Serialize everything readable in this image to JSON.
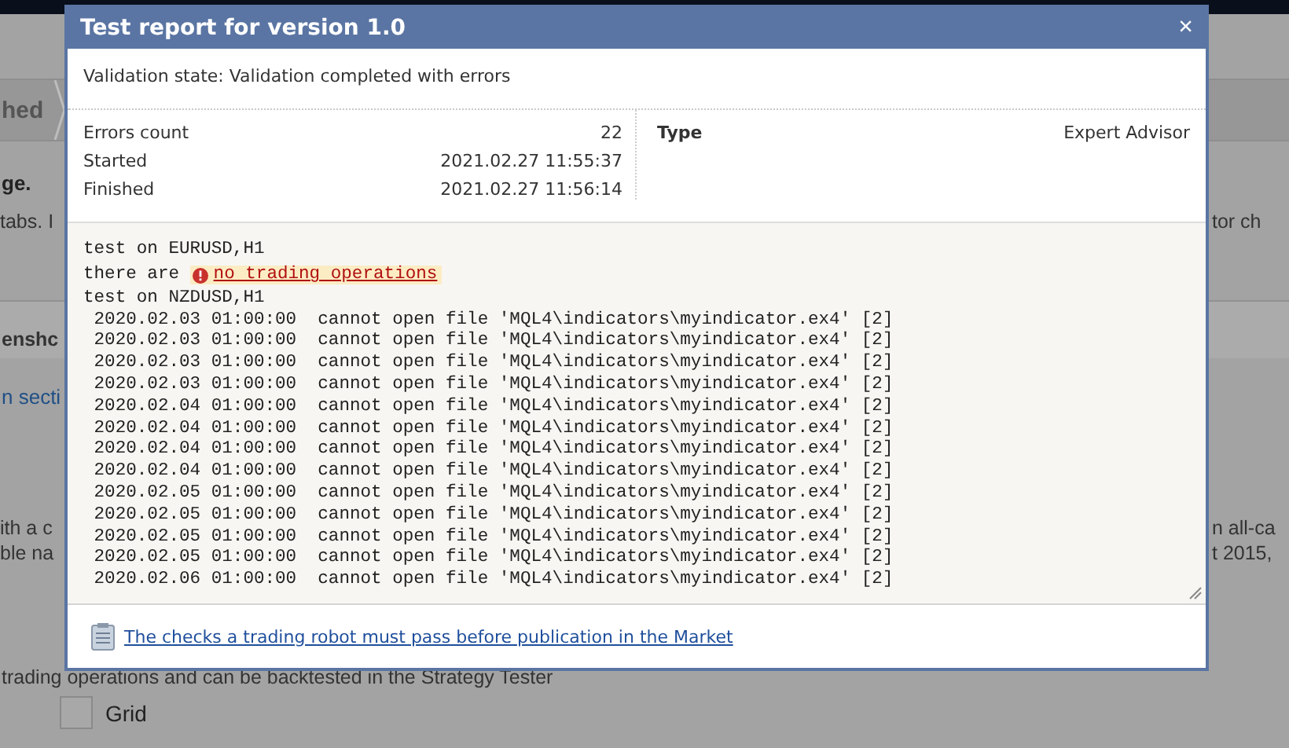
{
  "background": {
    "step_label": "hed",
    "heading_fragment": "ge.",
    "text_left": "tabs. I",
    "text_right": "tor ch",
    "section_tab": "enshc",
    "section_link": "n secti",
    "paragraph_left": [
      "ith a c",
      "ble na"
    ],
    "paragraph_right": [
      "n all-ca",
      "t 2015,"
    ],
    "trading_line": "trading operations and can be backtested in the Strategy Tester",
    "options": [
      {
        "label": "Grid",
        "checked": false
      }
    ]
  },
  "dialog": {
    "title": "Test report for version 1.0",
    "close": "×",
    "validation_state": "Validation state: Validation completed with errors",
    "summary": [
      {
        "label": "Errors count",
        "value": "22"
      },
      {
        "label": "Started",
        "value": "2021.02.27 11:55:37"
      },
      {
        "label": "Finished",
        "value": "2021.02.27 11:56:14"
      }
    ],
    "type": {
      "label": "Type",
      "value": "Expert Advisor"
    },
    "log": [
      {
        "kind": "plain",
        "text": "test on EURUSD,H1"
      },
      {
        "kind": "error",
        "text": "there are ",
        "error": "no trading operations"
      },
      {
        "kind": "plain",
        "text": "test on NZDUSD,H1"
      },
      {
        "kind": "plain",
        "text": " 2020.02.03 01:00:00  cannot open file 'MQL4\\indicators\\myindicator.ex4' [2]"
      },
      {
        "kind": "plain",
        "text": " 2020.02.03 01:00:00  cannot open file 'MQL4\\indicators\\myindicator.ex4' [2]"
      },
      {
        "kind": "plain",
        "text": " 2020.02.03 01:00:00  cannot open file 'MQL4\\indicators\\myindicator.ex4' [2]"
      },
      {
        "kind": "plain",
        "text": " 2020.02.03 01:00:00  cannot open file 'MQL4\\indicators\\myindicator.ex4' [2]"
      },
      {
        "kind": "plain",
        "text": " 2020.02.04 01:00:00  cannot open file 'MQL4\\indicators\\myindicator.ex4' [2]"
      },
      {
        "kind": "plain",
        "text": " 2020.02.04 01:00:00  cannot open file 'MQL4\\indicators\\myindicator.ex4' [2]"
      },
      {
        "kind": "plain",
        "text": " 2020.02.04 01:00:00  cannot open file 'MQL4\\indicators\\myindicator.ex4' [2]"
      },
      {
        "kind": "plain",
        "text": " 2020.02.04 01:00:00  cannot open file 'MQL4\\indicators\\myindicator.ex4' [2]"
      },
      {
        "kind": "plain",
        "text": " 2020.02.05 01:00:00  cannot open file 'MQL4\\indicators\\myindicator.ex4' [2]"
      },
      {
        "kind": "plain",
        "text": " 2020.02.05 01:00:00  cannot open file 'MQL4\\indicators\\myindicator.ex4' [2]"
      },
      {
        "kind": "plain",
        "text": " 2020.02.05 01:00:00  cannot open file 'MQL4\\indicators\\myindicator.ex4' [2]"
      },
      {
        "kind": "plain",
        "text": " 2020.02.05 01:00:00  cannot open file 'MQL4\\indicators\\myindicator.ex4' [2]"
      },
      {
        "kind": "plain",
        "text": " 2020.02.06 01:00:00  cannot open file 'MQL4\\indicators\\myindicator.ex4' [2]"
      }
    ],
    "footer_link": "The checks a trading robot must pass before publication in the Market"
  }
}
